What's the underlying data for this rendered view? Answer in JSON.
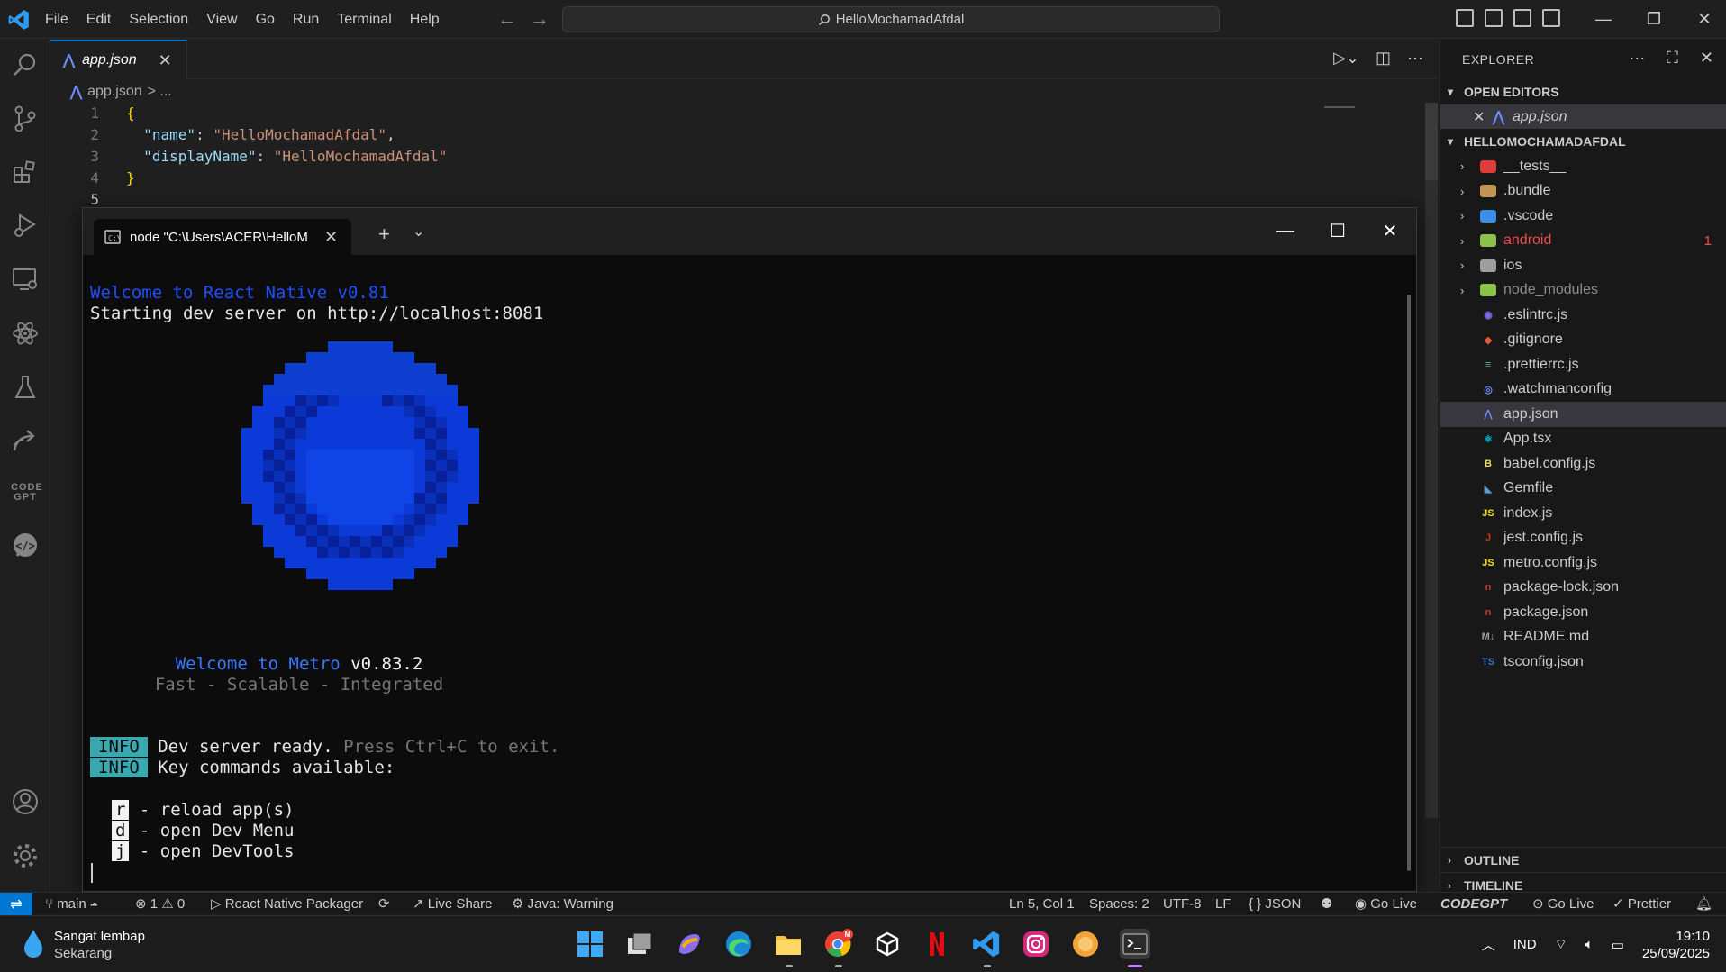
{
  "titlebar": {
    "menu": [
      "File",
      "Edit",
      "Selection",
      "View",
      "Go",
      "Run",
      "Terminal",
      "Help"
    ],
    "search": "HelloMochamadAfdal"
  },
  "editor": {
    "tab_label": "app.json",
    "breadcrumb_file": "app.json",
    "breadcrumb_sep": "> ...",
    "lines": [
      {
        "n": "1",
        "parts": [
          {
            "t": "{",
            "c": "brace"
          }
        ]
      },
      {
        "n": "2",
        "parts": [
          {
            "t": "  ",
            "c": "punct"
          },
          {
            "t": "\"name\"",
            "c": "key"
          },
          {
            "t": ": ",
            "c": "punct"
          },
          {
            "t": "\"HelloMochamadAfdal\"",
            "c": "str"
          },
          {
            "t": ",",
            "c": "punct"
          }
        ]
      },
      {
        "n": "3",
        "parts": [
          {
            "t": "  ",
            "c": "punct"
          },
          {
            "t": "\"displayName\"",
            "c": "key"
          },
          {
            "t": ": ",
            "c": "punct"
          },
          {
            "t": "\"HelloMochamadAfdal\"",
            "c": "str"
          }
        ]
      },
      {
        "n": "4",
        "parts": [
          {
            "t": "}",
            "c": "brace"
          }
        ]
      },
      {
        "n": "5",
        "parts": []
      }
    ]
  },
  "terminal": {
    "tab_label": "node  \"C:\\Users\\ACER\\HelloM",
    "line_welcome_rn": "Welcome to React Native v0.81",
    "line_starting": "Starting dev server on http://localhost:8081",
    "metro_welcome": "Welcome to Metro",
    "metro_version": "v0.83.2",
    "metro_tagline": "Fast - Scalable - Integrated",
    "info_label": "INFO",
    "info1_main": "Dev server ready.",
    "info1_hint": "Press Ctrl+C to exit.",
    "info2_main": "Key commands available:",
    "commands": [
      {
        "key": "r",
        "desc": "- reload app(s)"
      },
      {
        "key": "d",
        "desc": "- open Dev Menu"
      },
      {
        "key": "j",
        "desc": "- open DevTools"
      }
    ]
  },
  "explorer": {
    "header": "EXPLORER",
    "open_editors": "OPEN EDITORS",
    "open_file": "app.json",
    "project": "HELLOMOCHAMADAFDAL",
    "items": [
      {
        "name": "__tests__",
        "folder": true,
        "icon": "tests-folder-icon",
        "color": "#e03c3c",
        "glyph": "✱"
      },
      {
        "name": ".bundle",
        "folder": true,
        "icon": "folder-icon",
        "color": "#c09553",
        "glyph": ""
      },
      {
        "name": ".vscode",
        "folder": true,
        "icon": "vscode-folder-icon",
        "color": "#3b8eea",
        "glyph": ""
      },
      {
        "name": "android",
        "folder": true,
        "icon": "android-folder-icon",
        "color": "#8bc34a",
        "glyph": "",
        "badge": "1",
        "error": true
      },
      {
        "name": "ios",
        "folder": true,
        "icon": "ios-folder-icon",
        "color": "#9e9e9e",
        "glyph": ""
      },
      {
        "name": "node_modules",
        "folder": true,
        "icon": "node-folder-icon",
        "color": "#8bc34a",
        "glyph": "",
        "dim": true
      },
      {
        "name": ".eslintrc.js",
        "icon": "eslint-icon",
        "color": "#7c6fe6",
        "glyph": "◉"
      },
      {
        "name": ".gitignore",
        "icon": "git-icon",
        "color": "#e8533a",
        "glyph": "◆"
      },
      {
        "name": ".prettierrc.js",
        "icon": "prettier-icon",
        "color": "#56b3b4",
        "glyph": "≡"
      },
      {
        "name": ".watchmanconfig",
        "icon": "watchman-icon",
        "color": "#6f8cff",
        "glyph": "◎"
      },
      {
        "name": "app.json",
        "icon": "app-json-icon",
        "color": "#6d8cff",
        "glyph": "⋀",
        "selected": true
      },
      {
        "name": "App.tsx",
        "icon": "react-icon",
        "color": "#00bcd4",
        "glyph": "⚛"
      },
      {
        "name": "babel.config.js",
        "icon": "babel-icon",
        "color": "#f5da55",
        "glyph": "B"
      },
      {
        "name": "Gemfile",
        "icon": "gemfile-icon",
        "color": "#5b9bd5",
        "glyph": "◣"
      },
      {
        "name": "index.js",
        "icon": "js-icon",
        "color": "#f5de19",
        "glyph": "JS"
      },
      {
        "name": "jest.config.js",
        "icon": "jest-icon",
        "color": "#c63d14",
        "glyph": "J"
      },
      {
        "name": "metro.config.js",
        "icon": "js-icon",
        "color": "#f5de19",
        "glyph": "JS"
      },
      {
        "name": "package-lock.json",
        "icon": "npm-icon",
        "color": "#cb3837",
        "glyph": "n"
      },
      {
        "name": "package.json",
        "icon": "npm-icon",
        "color": "#cb3837",
        "glyph": "n"
      },
      {
        "name": "README.md",
        "icon": "markdown-icon",
        "color": "#9e9e9e",
        "glyph": "M↓"
      },
      {
        "name": "tsconfig.json",
        "icon": "tsconfig-icon",
        "color": "#3178c6",
        "glyph": "TS"
      }
    ],
    "outline": "OUTLINE",
    "timeline": "TIMELINE"
  },
  "statusbar": {
    "branch": "main",
    "problems": "⊗ 1 ⚠ 0",
    "packager": "React Native Packager",
    "liveshare": "Live Share",
    "java": "Java: Warning",
    "position": "Ln 5, Col 1",
    "spaces": "Spaces: 2",
    "encoding": "UTF-8",
    "eol": "LF",
    "language": "{ } JSON",
    "golive1": "Go Live",
    "codegpt": "CODEGPT",
    "golive2": "Go Live",
    "prettier": "Prettier"
  },
  "taskbar": {
    "weather_title": "Sangat lembap",
    "weather_sub": "Sekarang",
    "lang": "IND",
    "time": "19:10",
    "date": "25/09/2025",
    "chrome_badge": "M"
  }
}
